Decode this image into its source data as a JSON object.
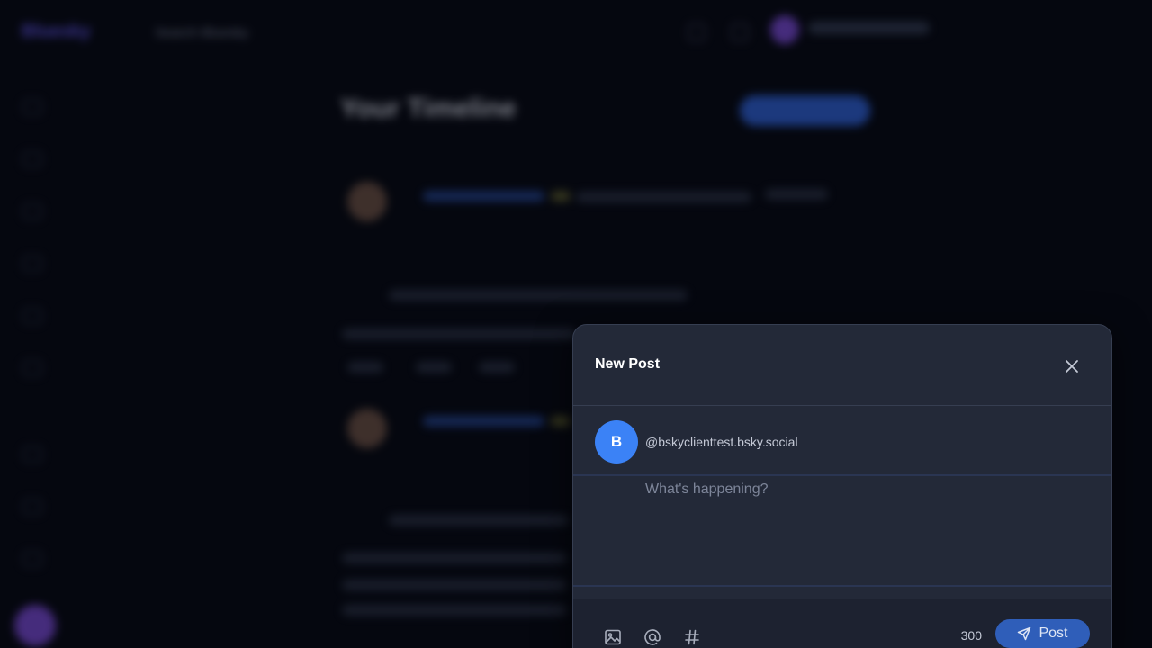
{
  "background": {
    "logo": "Bluesky",
    "search_label": "Search Bluesky",
    "page_title": "Your Timeline"
  },
  "modal": {
    "title": "New Post",
    "author": {
      "avatar_letter": "B",
      "handle": "@bskyclienttest.bsky.social"
    },
    "compose": {
      "placeholder": "What's happening?",
      "value": ""
    },
    "toolbar": {
      "char_count": "300",
      "post_label": "Post",
      "icons": [
        "image-icon",
        "mention-icon",
        "hashtag-icon"
      ]
    }
  },
  "colors": {
    "modal_bg": "#232938",
    "accent": "#3b82f6",
    "post_button": "#2f5eb9"
  }
}
